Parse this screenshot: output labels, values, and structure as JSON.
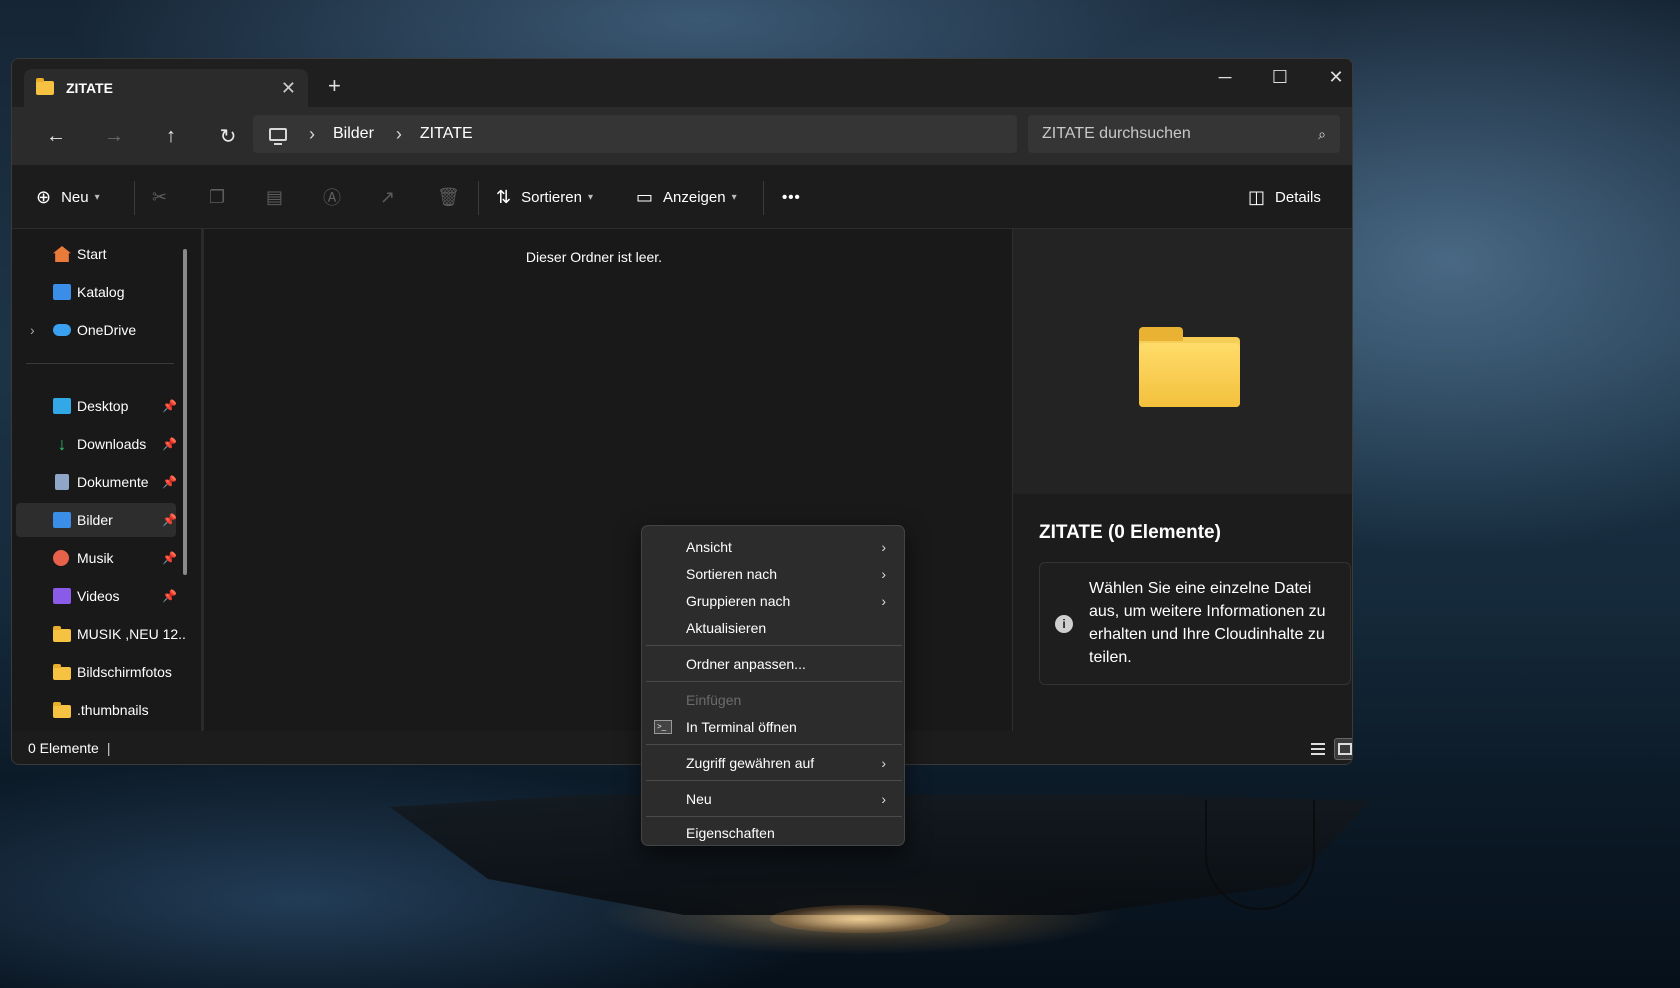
{
  "window": {
    "tab_title": "ZITATE",
    "tab_close": "✕",
    "new_tab": "+",
    "minimize": "─",
    "maximize": "☐",
    "close": "✕"
  },
  "nav": {
    "back": "←",
    "forward": "→",
    "up": "↑",
    "refresh": "↻",
    "breadcrumb": [
      "Bilder",
      "ZITATE"
    ],
    "separator": "›",
    "search_placeholder": "ZITATE durchsuchen",
    "search_icon": "⌕"
  },
  "toolbar": {
    "new_icon": "⊕",
    "new_label": "Neu",
    "sort_icon": "⇅",
    "sort_label": "Sortieren",
    "view_icon": "▭",
    "view_label": "Anzeigen",
    "more_label": "•••",
    "details_icon": "◫",
    "details_label": "Details",
    "cut_icon": "✂",
    "copy_icon": "❐",
    "paste_icon": "▤",
    "rename_icon": "Ⓐ",
    "share_icon": "↗",
    "delete_icon": "🗑"
  },
  "sidebar": {
    "items": [
      {
        "label": "Start",
        "icon": "home-icon",
        "color": "#e87a3a"
      },
      {
        "label": "Katalog",
        "icon": "gallery-icon",
        "color": "#3a8ee8"
      },
      {
        "label": "OneDrive",
        "icon": "cloud-icon",
        "color": "#3aa0f0"
      },
      {
        "label": "Desktop",
        "icon": "desktop-icon",
        "color": "#32a9e6"
      },
      {
        "label": "Downloads",
        "icon": "download-icon",
        "color": "#2fbf71"
      },
      {
        "label": "Dokumente",
        "icon": "document-icon",
        "color": "#8fa6c8"
      },
      {
        "label": "Bilder",
        "icon": "pictures-icon",
        "color": "#3a8ee8"
      },
      {
        "label": "Musik",
        "icon": "music-icon",
        "color": "#e8614a"
      },
      {
        "label": "Videos",
        "icon": "video-icon",
        "color": "#8a5be8"
      },
      {
        "label": "MUSIK ,NEU 12..",
        "icon": "folder-icon",
        "color": "#f5c242"
      },
      {
        "label": "Bildschirmfotos",
        "icon": "folder-icon",
        "color": "#f5c242"
      },
      {
        "label": ".thumbnails",
        "icon": "folder-icon",
        "color": "#f5c242"
      }
    ],
    "pin": "📌",
    "expand": "›"
  },
  "content": {
    "empty_message": "Dieser Ordner ist leer."
  },
  "details": {
    "title": "ZITATE (0 Elemente)",
    "info_icon": "i",
    "info_text": "Wählen Sie eine einzelne Datei aus, um weitere Informationen zu erhalten und Ihre Cloudinhalte zu teilen."
  },
  "status": {
    "count": "0 Elemente",
    "cursor": "|"
  },
  "context_menu": {
    "items": [
      {
        "label": "Ansicht",
        "arrow": "›"
      },
      {
        "label": "Sortieren nach",
        "arrow": "›"
      },
      {
        "label": "Gruppieren nach",
        "arrow": "›"
      },
      {
        "label": "Aktualisieren"
      },
      {
        "label": "Ordner anpassen..."
      },
      {
        "label": "Einfügen",
        "disabled": true
      },
      {
        "label": "In Terminal öffnen",
        "icon": ">_"
      },
      {
        "label": "Zugriff gewähren auf",
        "arrow": "›"
      },
      {
        "label": "Neu",
        "arrow": "›"
      },
      {
        "label": "Eigenschaften"
      }
    ]
  }
}
